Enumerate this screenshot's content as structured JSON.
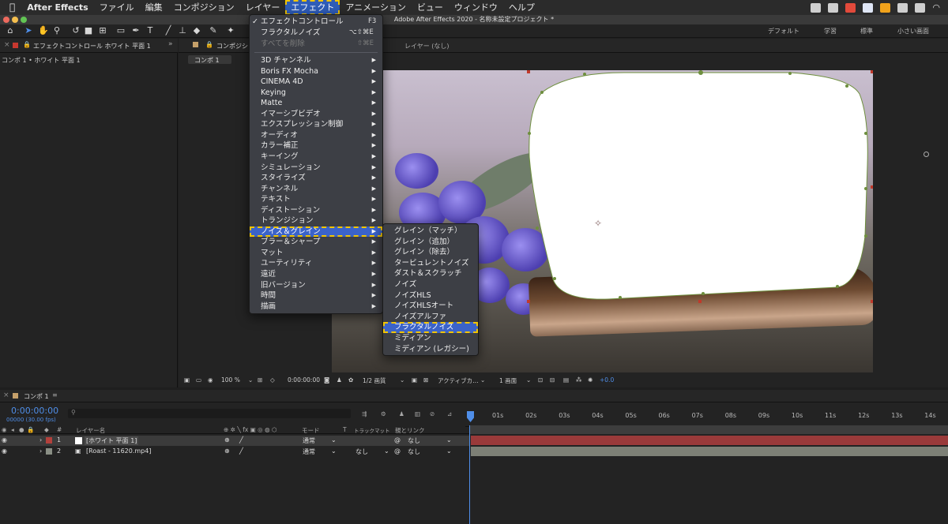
{
  "menubar": {
    "apple": "",
    "app_name": "After Effects",
    "items": [
      "ファイル",
      "編集",
      "コンポジション",
      "レイヤー",
      "エフェクト",
      "アニメーション",
      "ビュー",
      "ウィンドウ",
      "ヘルプ"
    ]
  },
  "window_title": "Adobe After Effects 2020 - 名称未設定プロジェクト *",
  "workspaces": [
    "デフォルト",
    "学習",
    "標準",
    "小さい画面"
  ],
  "left_panel": {
    "tab": "エフェクトコントロール ホワイト 平面 1",
    "subtitle": "コンポ 1 • ホワイト 平面 1"
  },
  "comp_panel": {
    "tab": "コンポジシ",
    "comp_tab": "コンポ 1",
    "layer_label": "レイヤー (なし)"
  },
  "effect_menu": {
    "top_items": [
      {
        "label": "エフェクトコントロール",
        "shortcut": "F3",
        "checked": true
      },
      {
        "label": "フラクタルノイズ",
        "shortcut": "⌥⇧⌘E",
        "checked": false
      },
      {
        "label": "すべてを削除",
        "shortcut": "⇧⌘E",
        "disabled": true
      }
    ],
    "categories": [
      "3D チャンネル",
      "Boris FX Mocha",
      "CINEMA 4D",
      "Keying",
      "Matte",
      "イマーシブビデオ",
      "エクスプレッション制御",
      "オーディオ",
      "カラー補正",
      "キーイング",
      "シミュレーション",
      "スタイライズ",
      "チャンネル",
      "テキスト",
      "ディストーション",
      "トランジション",
      "ノイズ＆グレイン",
      "ブラー＆シャープ",
      "マット",
      "ユーティリティ",
      "遠近",
      "旧バージョン",
      "時間",
      "描画"
    ],
    "highlighted": "ノイズ＆グレイン"
  },
  "noise_submenu": {
    "items": [
      "グレイン（マッチ）",
      "グレイン（追加）",
      "グレイン（除去）",
      "タービュレントノイズ",
      "ダスト＆スクラッチ",
      "ノイズ",
      "ノイズHLS",
      "ノイズHLSオート",
      "ノイズアルファ",
      "フラクタルノイズ",
      "ミディアン",
      "ミディアン (レガシー)"
    ],
    "highlighted": "フラクタルノイズ"
  },
  "viewer_bar": {
    "zoom": "100 %",
    "time": "0:00:00:00",
    "resolution": "1/2 画質",
    "camera": "アクティブカ…",
    "views": "1 画面",
    "exposure": "+0.0"
  },
  "timeline": {
    "tab": "コンポ 1",
    "timecode": "0:00:00:00",
    "frames": "00000 (30.00 fps)",
    "search_placeholder": "",
    "columns": {
      "layer_name": "レイヤー名",
      "mode": "モード",
      "t": "T",
      "trkmat": "トラックマット",
      "parent": "親とリンク"
    },
    "ruler": [
      "0s",
      "01s",
      "02s",
      "03s",
      "04s",
      "05s",
      "06s",
      "07s",
      "08s",
      "09s",
      "10s",
      "11s",
      "12s",
      "13s",
      "14s"
    ],
    "layers": [
      {
        "index": "1",
        "name": "[ホワイト 平面 1]",
        "mode": "通常",
        "trkmat": "",
        "parent": "なし",
        "color": "#b3413c"
      },
      {
        "index": "2",
        "name": "[Roast - 11620.mp4]",
        "mode": "通常",
        "trkmat": "なし",
        "parent": "なし",
        "color": "#8a8f85"
      }
    ]
  },
  "colors": {
    "menu_highlight": "#3b63c9",
    "dash_outline": "#f2c500",
    "layer1_bar": "#9a3a3a",
    "layer2_bar": "#7d8076"
  }
}
